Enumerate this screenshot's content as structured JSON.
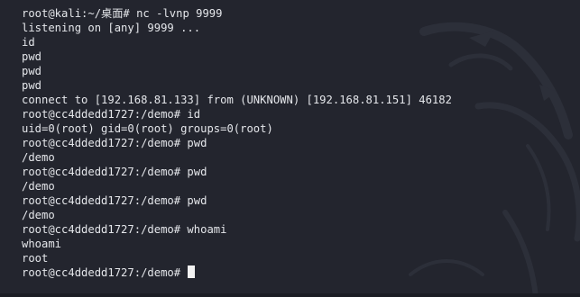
{
  "terminal": {
    "lines": [
      "root@kali:~/桌面# nc -lvnp 9999",
      "listening on [any] 9999 ...",
      "id",
      "pwd",
      "pwd",
      "pwd",
      "connect to [192.168.81.133] from (UNKNOWN) [192.168.81.151] 46182",
      "root@cc4ddedd1727:/demo# id",
      "uid=0(root) gid=0(root) groups=0(root)",
      "root@cc4ddedd1727:/demo# pwd",
      "/demo",
      "root@cc4ddedd1727:/demo# pwd",
      "/demo",
      "root@cc4ddedd1727:/demo# pwd",
      "/demo",
      "root@cc4ddedd1727:/demo# whoami",
      "whoami",
      "root",
      "root@cc4ddedd1727:/demo# "
    ],
    "colors": {
      "background": "#23252e",
      "text": "#e4e6ea",
      "cursor": "#f2f2f2",
      "watermark": "#2c2f39"
    },
    "watermark_icon": "kali-dragon-icon"
  }
}
